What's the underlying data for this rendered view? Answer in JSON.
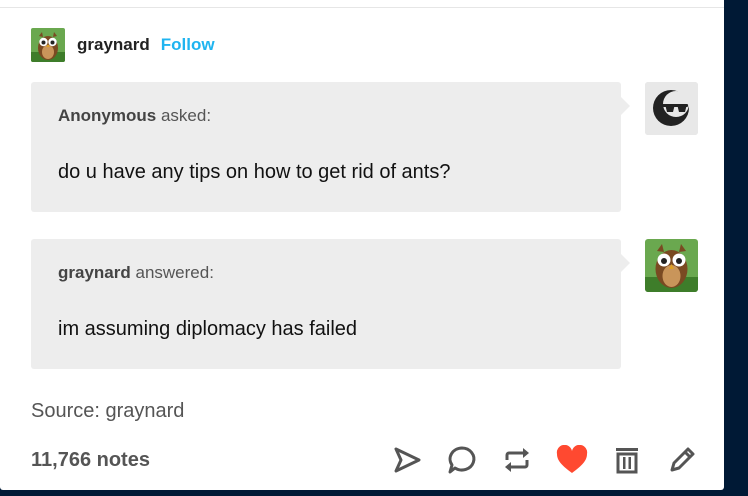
{
  "post": {
    "author": "graynard",
    "follow_label": "Follow",
    "ask": {
      "asker": "Anonymous",
      "verb": "asked:",
      "question": "do u have any tips on how to get rid of ants?"
    },
    "answer": {
      "author": "graynard",
      "verb": "answered:",
      "text": "im assuming diplomacy has failed"
    },
    "source": "Source: graynard",
    "notes": "11,766 notes"
  },
  "icons": [
    "owl-avatar-icon",
    "anonymous-sunglasses-icon",
    "share-icon",
    "reply-icon",
    "reblog-icon",
    "heart-icon",
    "delete-icon",
    "edit-icon"
  ],
  "colors": {
    "follow": "#1fb4f0",
    "like": "#ff4930",
    "bubble": "#ededed",
    "background": "#001935"
  }
}
